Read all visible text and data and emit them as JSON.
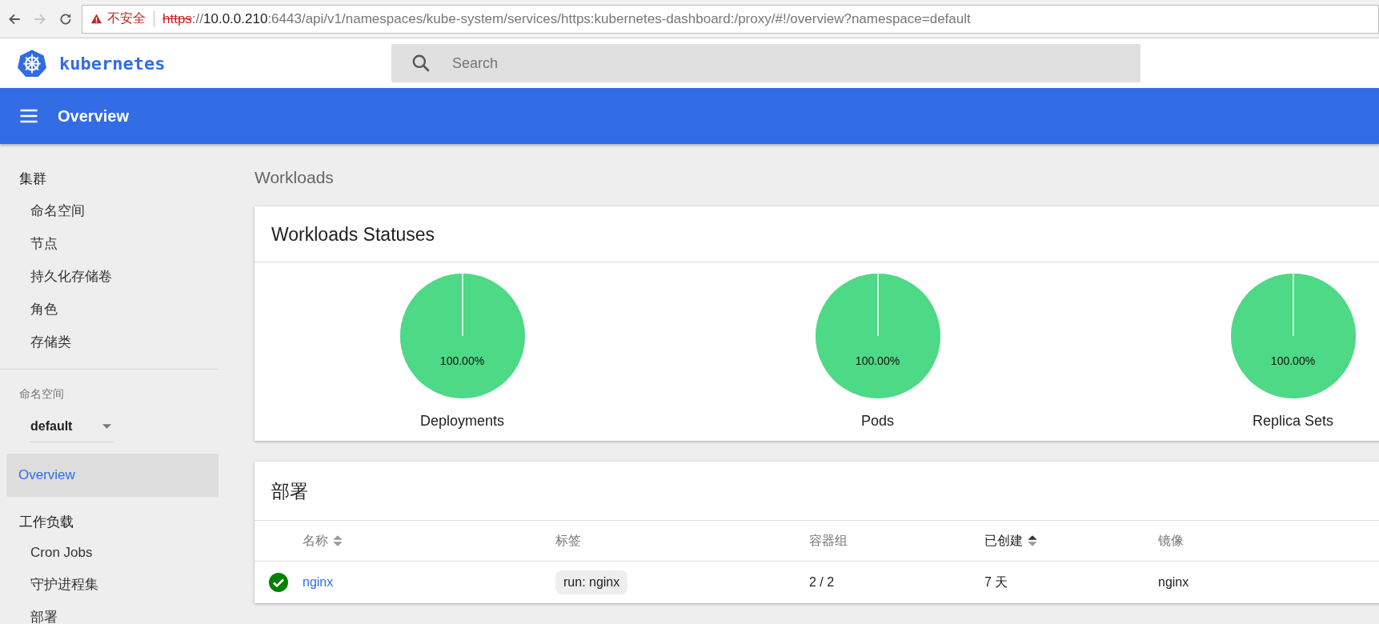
{
  "browser": {
    "back_enabled": true,
    "forward_enabled": false,
    "insecure_label": "不安全",
    "url_parts": [
      {
        "kind": "scheme",
        "text": "https"
      },
      {
        "kind": "dim",
        "text": "://"
      },
      {
        "kind": "host",
        "text": "10.0.0.210"
      },
      {
        "kind": "dim",
        "text": ":6443/api/v1/namespaces/kube-system/services/https:kubernetes-dashboard:/proxy/#!/overview?namespace=default"
      }
    ]
  },
  "header": {
    "logo_text": "kubernetes",
    "search": {
      "placeholder": "Search"
    }
  },
  "toolbar": {
    "title": "Overview"
  },
  "sidebar": {
    "sections": [
      {
        "kind": "group",
        "label": "集群",
        "children": [
          {
            "label": "命名空间"
          },
          {
            "label": "节点"
          },
          {
            "label": "持久化存储卷"
          },
          {
            "label": "角色"
          },
          {
            "label": "存储类"
          }
        ]
      },
      {
        "kind": "namespace",
        "label": "命名空间",
        "value": "default"
      },
      {
        "kind": "link",
        "label": "Overview",
        "selected": true
      },
      {
        "kind": "group",
        "label": "工作负载",
        "children": [
          {
            "label": "Cron Jobs"
          },
          {
            "label": "守护进程集"
          },
          {
            "label": "部署"
          }
        ]
      }
    ]
  },
  "content": {
    "heading": "Workloads",
    "statuses": {
      "title": "Workloads Statuses",
      "charts": [
        {
          "title": "Deployments",
          "level": 1,
          "percent": "100.00%"
        },
        {
          "title": "Pods",
          "level": 1,
          "percent": "100.00%"
        },
        {
          "title": "Replica Sets",
          "level": 1,
          "percent": "100.00%"
        }
      ]
    },
    "deployments": {
      "title": "部署",
      "columns": [
        {
          "label": "名称",
          "sortable": true,
          "sorted": false
        },
        {
          "label": "标签",
          "sortable": false,
          "sorted": false
        },
        {
          "label": "容器组",
          "sortable": false,
          "sorted": false
        },
        {
          "label": "已创建",
          "sortable": true,
          "sorted": true
        },
        {
          "label": "镜像",
          "sortable": false,
          "sorted": false
        }
      ],
      "rows": [
        {
          "healthy": true,
          "name": "nginx",
          "labels": [
            "run: nginx"
          ],
          "pods": "2 / 2",
          "age": "7 天",
          "image": "nginx"
        }
      ]
    }
  }
}
